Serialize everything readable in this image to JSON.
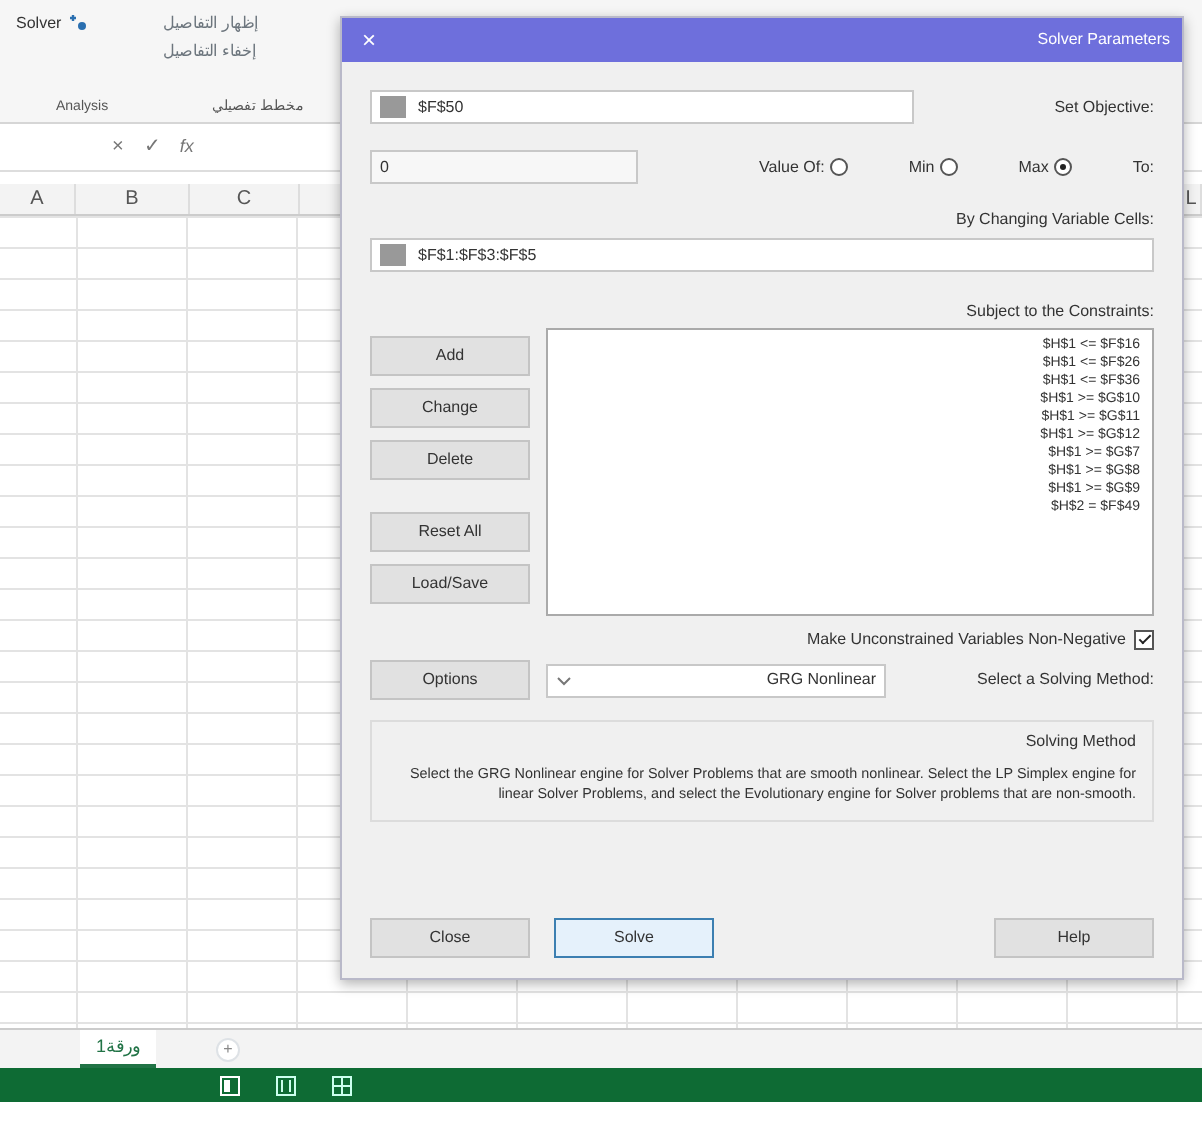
{
  "ribbon": {
    "solver_button": "Solver",
    "outline_items": [
      "إظهار التفاصيل",
      "إخفاء التفاصيل"
    ],
    "groups": [
      "Analysis",
      "مخطط تفصيلي"
    ]
  },
  "formula_bar": {
    "cancel": "×",
    "enter": "✓",
    "function": "fx"
  },
  "columns": [
    "A",
    "B",
    "C",
    "L"
  ],
  "dialog": {
    "title": "Solver Parameters",
    "close": "×",
    "objective": {
      "label": "Set Objective:",
      "value": "$F$50"
    },
    "to": {
      "label": "To:",
      "options": [
        {
          "label": "Value Of:",
          "selected": false
        },
        {
          "label": "Min",
          "selected": false
        },
        {
          "label": "Max",
          "selected": true
        }
      ],
      "value": "0"
    },
    "variables": {
      "label": "By Changing Variable Cells:",
      "value": "$F$1:$F$3:$F$5"
    },
    "constraints": {
      "label": "Subject to the Constraints:",
      "items": [
        "$H$1 <= $F$16",
        "$H$1 <= $F$26",
        "$H$1 <= $F$36",
        "$H$1 >= $G$10",
        "$H$1 >= $G$11",
        "$H$1 >= $G$12",
        "$H$1 >= $G$7",
        "$H$1 >= $G$8",
        "$H$1 >= $G$9",
        "$H$2 = $F$49"
      ]
    },
    "side_buttons": [
      "Add",
      "Change",
      "Delete",
      "Reset All",
      "Load/Save"
    ],
    "nonnegative": {
      "label": "Make Unconstrained Variables Non-Negative",
      "checked": true
    },
    "method": {
      "label": "Select a Solving Method:",
      "value": "GRG Nonlinear",
      "options_button": "Options"
    },
    "method_group": {
      "title": "Solving Method",
      "text": "Select the GRG Nonlinear engine for Solver Problems that are smooth nonlinear. Select the LP Simplex engine for linear Solver Problems, and select the Evolutionary engine for Solver problems that are non-smooth."
    },
    "footer": [
      {
        "label": "Close",
        "selected": false
      },
      {
        "label": "Solve",
        "selected": true
      },
      {
        "label": "Help",
        "selected": false
      }
    ]
  },
  "sheet_tabs": [
    {
      "label": "ورقة1",
      "selected": true
    }
  ],
  "new_sheet": "+"
}
